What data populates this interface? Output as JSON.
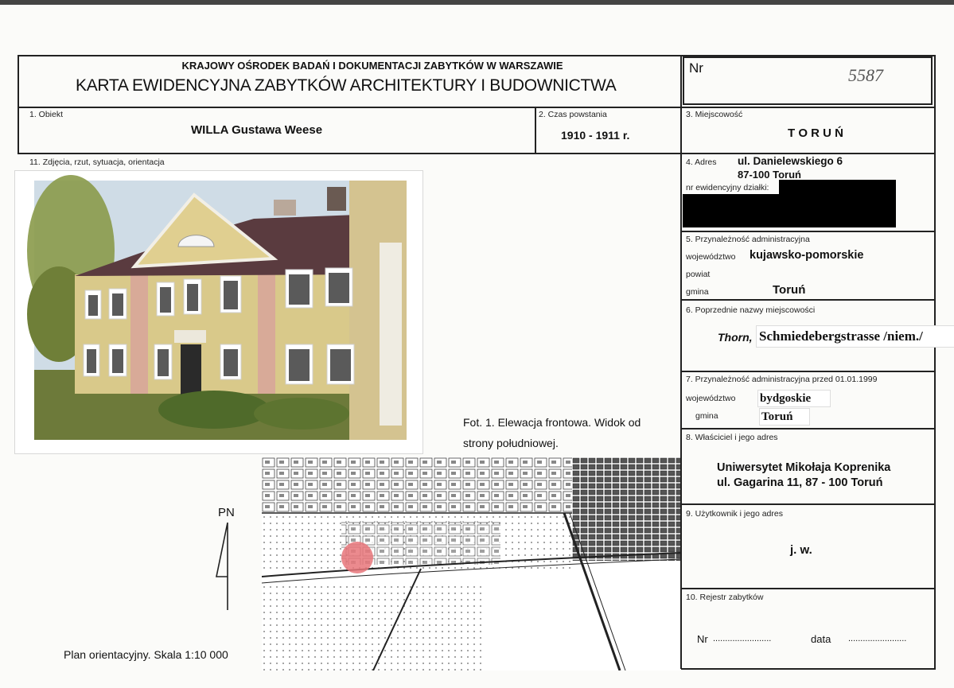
{
  "header": {
    "institution": "KRAJOWY OŚRODEK BADAŃ I DOKUMENTACJI ZABYTKÓW W WARSZAWIE",
    "form_title": "KARTA EWIDENCYJNA ZABYTKÓW ARCHITEKTURY I BUDOWNICTWA",
    "nr_label": "Nr",
    "nr_value": "5587"
  },
  "fields": {
    "obiekt_label": "1. Obiekt",
    "obiekt_value": "WILLA Gustawa Weese",
    "czas_label": "2. Czas powstania",
    "czas_value": "1910 - 1911 r.",
    "miejscowosc_label": "3. Miejscowość",
    "miejscowosc_value": "T O R U Ń",
    "adres_label": "4. Adres",
    "adres_line1": "ul. Danielewskiego 6",
    "adres_line2": "87-100 Toruń",
    "dzialki_label": "nr ewidencyjny działki:",
    "przynaleznosc_label": "5. Przynależność administracyjna",
    "wojewodztwo_label": "województwo",
    "wojewodztwo_value": "kujawsko-pomorskie",
    "powiat_label": "powiat",
    "gmina_label": "gmina",
    "gmina_value": "Toruń",
    "poprzednie_label": "6. Poprzednie nazwy miejscowości",
    "poprzednie_thorn": "Thorn,",
    "poprzednie_street": "Schmiedebergstrasse /niem./",
    "przed1999_label": "7. Przynależność administracyjna przed 01.01.1999",
    "woj1999_label": "województwo",
    "woj1999_value": "bydgoskie",
    "gmina1999_label": "gmina",
    "gmina1999_value": "Toruń",
    "wlasciciel_label": "8. Właściciel i jego adres",
    "wlasciciel_line1": "Uniwersytet Mikołaja Koprenika",
    "wlasciciel_line2": "ul. Gagarina 11, 87 - 100 Toruń",
    "uzytkownik_label": "9. Użytkownik i jego adres",
    "uzytkownik_value": "j. w.",
    "rejestr_label": "10. Rejestr zabytków",
    "rejestr_nr_label": "Nr",
    "rejestr_dots1": "........................",
    "rejestr_data_label": "data",
    "rejestr_dots2": "........................",
    "zdjecia_label": "11. Zdjęcia, rzut, sytuacja, orientacja"
  },
  "photo_caption_line1": "Fot. 1. Elewacja frontowa. Widok od",
  "photo_caption_line2": "strony południowej.",
  "north_label": "PN",
  "plan_caption": "Plan orientacyjny. Skala 1:10 000",
  "colors": {
    "marker": "#e8767a",
    "facade": "#d9c98a",
    "roof": "#5a3b3f"
  }
}
